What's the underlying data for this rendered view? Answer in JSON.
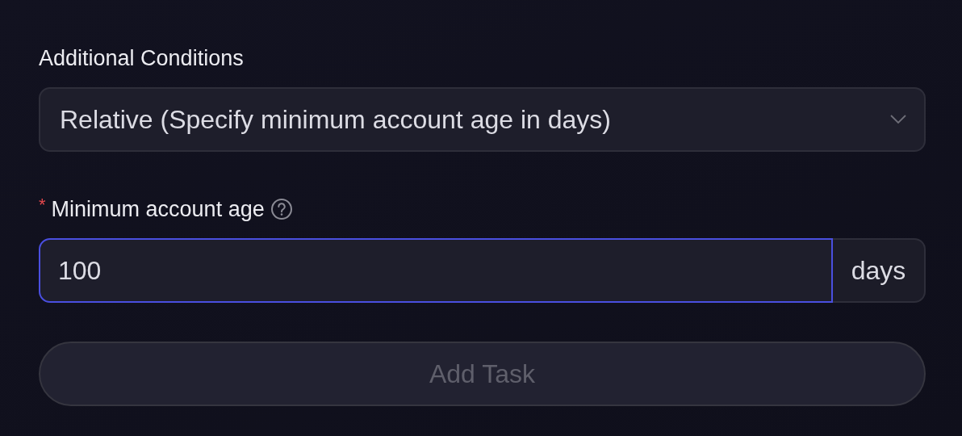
{
  "conditions": {
    "label": "Additional Conditions",
    "value": "Relative (Specify minimum account age in days)"
  },
  "account_age": {
    "label": "Minimum account age",
    "required_mark": "*",
    "value": "100",
    "focused": true,
    "suffix": "days"
  },
  "submit": {
    "label": "Add Task",
    "disabled": true
  }
}
